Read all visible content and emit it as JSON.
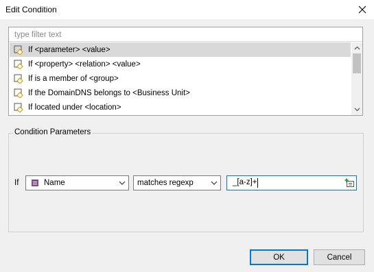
{
  "dialog": {
    "title": "Edit Condition"
  },
  "filter": {
    "placeholder": "type filter text"
  },
  "conditions": [
    {
      "label": "If <parameter> <value>",
      "selected": true
    },
    {
      "label": "If <property> <relation> <value>",
      "selected": false
    },
    {
      "label": "If is a member of <group>",
      "selected": false
    },
    {
      "label": "If the DomainDNS belongs to <Business Unit>",
      "selected": false
    },
    {
      "label": "If located under <location>",
      "selected": false
    }
  ],
  "parameters": {
    "group_title": "Condition Parameters",
    "if_label": "If",
    "parameter_value": "Name",
    "operator_value": "matches regexp",
    "value_text": "_[a-z]+"
  },
  "buttons": {
    "ok": "OK",
    "cancel": "Cancel"
  },
  "colors": {
    "accent": "#0078d7",
    "selection": "#d9d9d9",
    "icon_orange": "#d8a200",
    "param_icon": "#8b4a94"
  },
  "icons": [
    "close-icon",
    "condition-icon",
    "scroll-up-icon",
    "scroll-down-icon",
    "parameter-icon",
    "chevron-down-icon",
    "insert-parameter-icon"
  ]
}
